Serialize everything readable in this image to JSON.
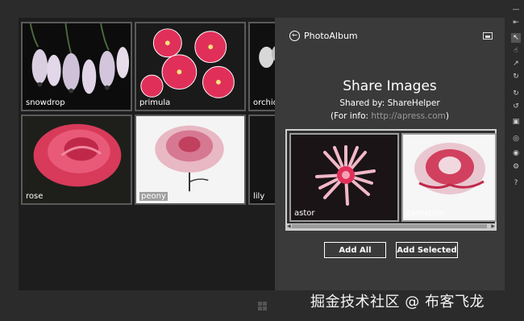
{
  "gallery": {
    "tiles": [
      {
        "label": "snowdrop"
      },
      {
        "label": "primula"
      },
      {
        "label": "orchid"
      },
      {
        "label": "rose"
      },
      {
        "label": "peony"
      },
      {
        "label": "lily"
      }
    ]
  },
  "share_pane": {
    "app_name": "PhotoAlbum",
    "title": "Share Images",
    "shared_by": "Shared by: ShareHelper",
    "for_info_prefix": "(For info: ",
    "for_info_link": "http://apress.com",
    "for_info_suffix": ")",
    "images": [
      {
        "label": "astor"
      },
      {
        "label": "carnation"
      }
    ],
    "add_all_label": "Add All",
    "add_selected_label": "Add Selected"
  },
  "toolbar": {
    "icons": [
      "minimize-icon",
      "pin-icon",
      "pointer-icon",
      "touch-icon",
      "pinch-icon",
      "rotate-gesture-icon",
      "rotate-cw-icon",
      "rotate-ccw-icon",
      "resolution-icon",
      "location-icon",
      "screenshot-icon",
      "settings-icon",
      "help-icon"
    ],
    "help": "?"
  },
  "watermark": "掘金技术社区 @ 布客飞龙",
  "colors": {
    "pane_bg": "#3a3a3a",
    "screen_bg": "#1d1d1d",
    "link": "#9a9a9a",
    "flower_pink": "#e0305a"
  }
}
